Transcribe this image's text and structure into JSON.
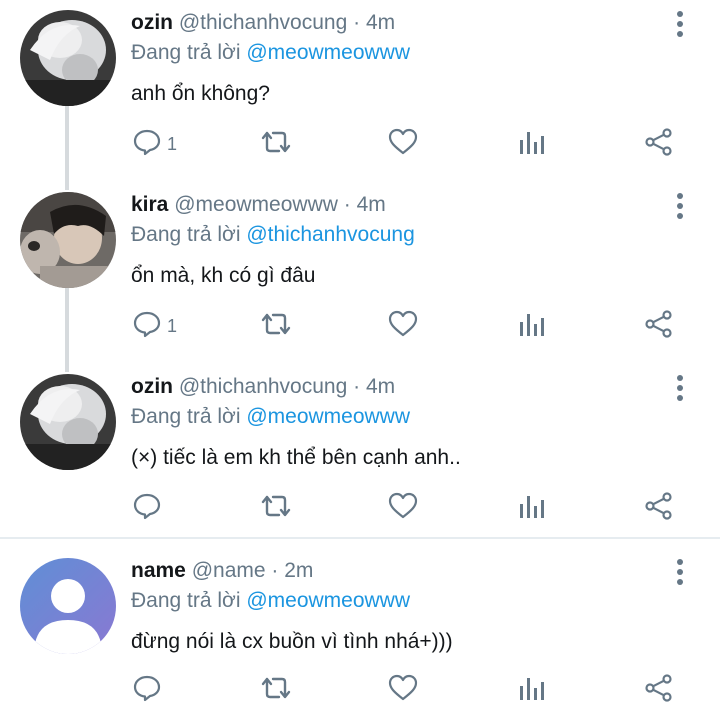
{
  "tweets": [
    {
      "name": "ozin",
      "handle": "@thichanhvocung",
      "separator": "·",
      "time": "4m",
      "replying_prefix": "Đang trả lời",
      "replying_to": "@meowmeowww",
      "text": "anh ổn không?",
      "reply_count": "1",
      "avatar": "ozin-avatar"
    },
    {
      "name": "kira",
      "handle": "@meowmeowww",
      "separator": "·",
      "time": "4m",
      "replying_prefix": "Đang trả lời",
      "replying_to": "@thichanhvocung",
      "text": "ổn mà, kh có gì đâu",
      "reply_count": "1",
      "avatar": "kira-avatar"
    },
    {
      "name": "ozin",
      "handle": "@thichanhvocung",
      "separator": "·",
      "time": "4m",
      "replying_prefix": "Đang trả lời",
      "replying_to": "@meowmeowww",
      "text": "(×) tiếc là em kh thể bên cạnh anh..",
      "reply_count": "",
      "avatar": "ozin-avatar"
    },
    {
      "name": "name",
      "handle": "@name",
      "separator": "·",
      "time": "2m",
      "replying_prefix": "Đang trả lời",
      "replying_to": "@meowmeowww",
      "text": "đừng nói là cx buồn vì tình nhá+)))",
      "reply_count": "",
      "avatar": "default-avatar"
    }
  ],
  "icons": {
    "reply": "reply-icon",
    "retweet": "retweet-icon",
    "like": "heart-icon",
    "analytics": "analytics-icon",
    "share": "share-icon",
    "more": "more-vertical-icon"
  },
  "colors": {
    "mention": "#1b95e0",
    "secondary": "#657786",
    "icon": "#657786",
    "thread_line": "#d6dadd",
    "default_avatar_bg": "#7c8ed8"
  }
}
